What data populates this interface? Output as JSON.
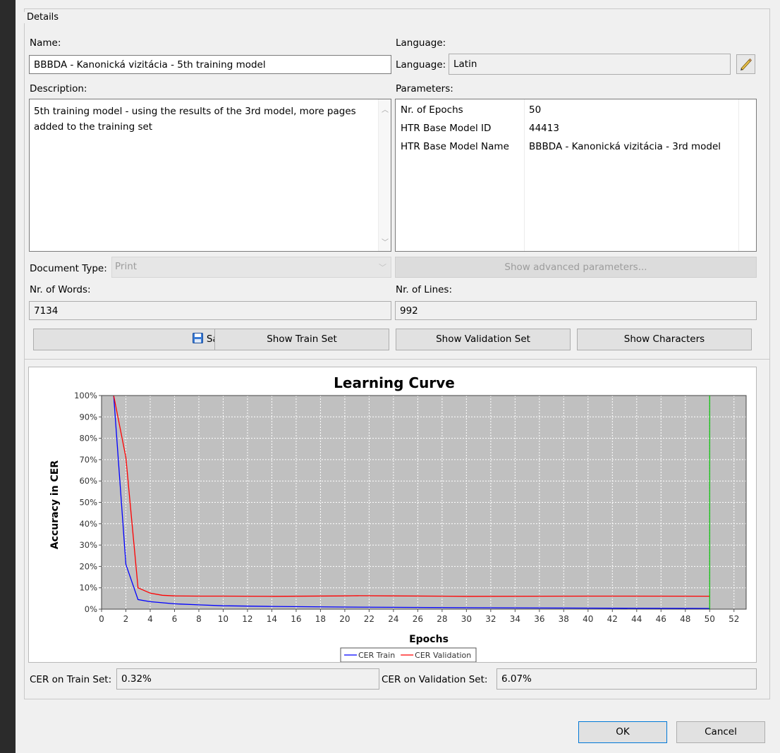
{
  "group_title": "Details",
  "name": {
    "label": "Name:",
    "value": "BBBDA - Kanonická vizitácia - 5th training model"
  },
  "language": {
    "section_label": "Language:",
    "field_label": "Language:",
    "value": "Latin",
    "edit_icon": "pencil-icon"
  },
  "description": {
    "label": "Description:",
    "value": "5th training model - using the results of the 3rd model, more pages added to the training set"
  },
  "parameters": {
    "label": "Parameters:",
    "rows": [
      {
        "key": "Nr. of Epochs",
        "value": "50"
      },
      {
        "key": "HTR Base Model ID",
        "value": "44413"
      },
      {
        "key": "HTR Base Model Name",
        "value": "BBBDA - Kanonická vizitácia - 3rd model"
      }
    ]
  },
  "document_type": {
    "label": "Document Type:",
    "value": "Print"
  },
  "advanced_button": "Show advanced parameters...",
  "words": {
    "label": "Nr. of Words:",
    "value": "7134"
  },
  "lines": {
    "label": "Nr. of Lines:",
    "value": "992"
  },
  "buttons": {
    "save": "Save",
    "train_set": "Show Train Set",
    "validation_set": "Show Validation Set",
    "characters": "Show Characters"
  },
  "chart_data": {
    "type": "line",
    "title": "Learning Curve",
    "xlabel": "Epochs",
    "ylabel": "Accuracy in CER",
    "xlim": [
      0,
      53
    ],
    "ylim": [
      0,
      1
    ],
    "x_ticks": [
      0,
      2,
      4,
      6,
      8,
      10,
      12,
      14,
      16,
      18,
      20,
      22,
      24,
      26,
      28,
      30,
      32,
      34,
      36,
      38,
      40,
      42,
      44,
      46,
      48,
      50,
      52
    ],
    "y_ticks": [
      "0%",
      "10%",
      "20%",
      "30%",
      "40%",
      "50%",
      "60%",
      "70%",
      "80%",
      "90%",
      "100%"
    ],
    "background": "#c0c0c0",
    "grid": true,
    "marker_line_x": 50,
    "marker_line_color": "#00c000",
    "legend_position": "bottom-center",
    "series": [
      {
        "name": "CER Train",
        "color": "#0000ff",
        "x": [
          1,
          2,
          3,
          4,
          5,
          6,
          8,
          10,
          14,
          20,
          30,
          40,
          50
        ],
        "y": [
          1.0,
          0.21,
          0.045,
          0.035,
          0.03,
          0.025,
          0.02,
          0.016,
          0.013,
          0.01,
          0.007,
          0.005,
          0.0032
        ]
      },
      {
        "name": "CER Validation",
        "color": "#ff0000",
        "x": [
          1,
          2,
          3,
          4,
          5,
          6,
          8,
          10,
          14,
          20,
          21,
          24,
          30,
          40,
          50
        ],
        "y": [
          1.0,
          0.71,
          0.1,
          0.075,
          0.065,
          0.062,
          0.061,
          0.061,
          0.06,
          0.062,
          0.063,
          0.062,
          0.06,
          0.061,
          0.0607
        ]
      }
    ]
  },
  "cer_train": {
    "label": "CER on Train Set:",
    "value": "0.32%"
  },
  "cer_validation": {
    "label": "CER on Validation Set:",
    "value": "6.07%"
  },
  "footer": {
    "ok": "OK",
    "cancel": "Cancel"
  }
}
